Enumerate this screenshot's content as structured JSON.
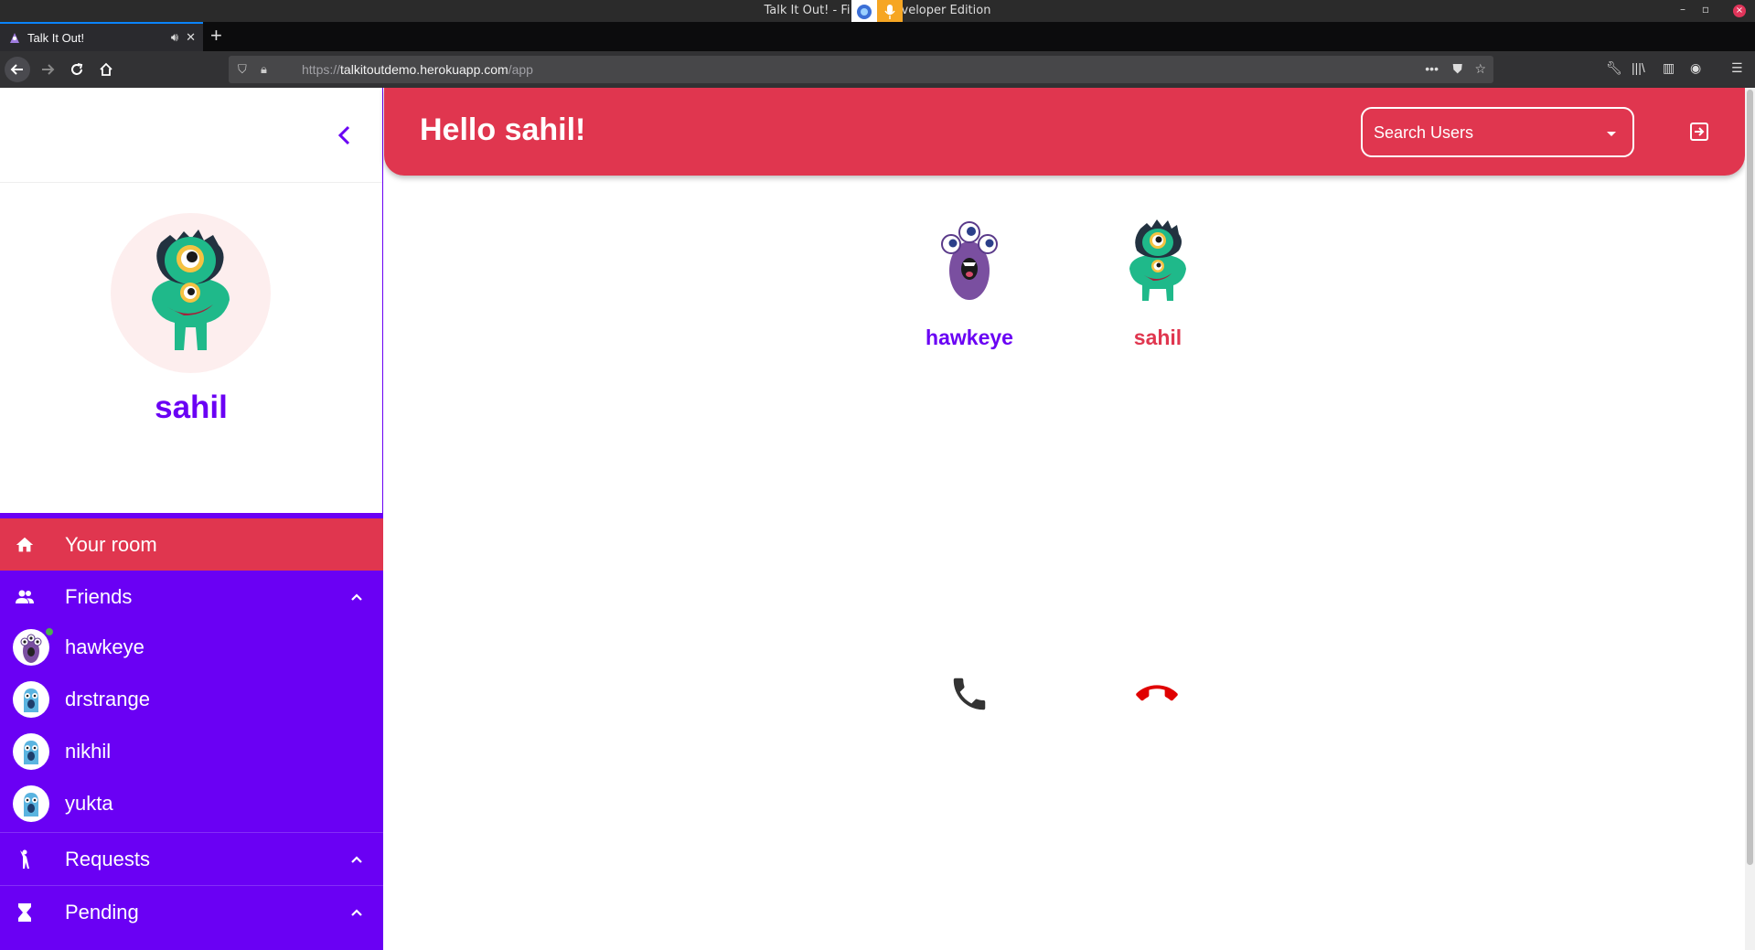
{
  "browser": {
    "window_title": "Talk It Out! - Firefox Developer Edition",
    "window_title_visible": "Talk It Out! - Fi",
    "window_title_tail": "veloper Edition",
    "tab_title": "Talk It Out!",
    "url_prefix": "https://",
    "url_host": "talkitoutdemo.herokuapp.com",
    "url_path": "/app"
  },
  "app": {
    "greeting": "Hello sahil!",
    "search_placeholder": "Search Users",
    "colors": {
      "primary": "#6a00f4",
      "accent": "#e0364f",
      "hangup": "#e00000"
    }
  },
  "sidebar": {
    "profile_name": "sahil",
    "menu": {
      "your_room": "Your room",
      "friends": "Friends",
      "requests": "Requests",
      "pending": "Pending"
    },
    "friends": [
      {
        "name": "hawkeye",
        "online": true
      },
      {
        "name": "drstrange",
        "online": false
      },
      {
        "name": "nikhil",
        "online": false
      },
      {
        "name": "yukta",
        "online": false
      }
    ]
  },
  "room": {
    "participants": [
      {
        "name": "hawkeye",
        "color": "#6a00f4"
      },
      {
        "name": "sahil",
        "color": "#e0364f"
      }
    ]
  }
}
